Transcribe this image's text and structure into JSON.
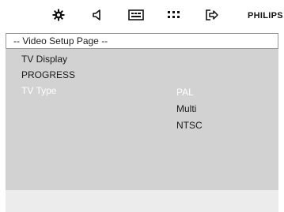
{
  "toolbar": {
    "icons": [
      "gear-icon",
      "speaker-icon",
      "subtitle-icon",
      "dots-grid-icon",
      "exit-icon"
    ],
    "brand": "PHILIPS"
  },
  "page": {
    "title": "-- Video Setup Page --"
  },
  "menu": {
    "items": [
      {
        "label": "TV Display"
      },
      {
        "label": "PROGRESS"
      },
      {
        "label": "TV Type",
        "selected": true
      }
    ]
  },
  "submenu": {
    "options": [
      {
        "label": "PAL",
        "highlighted": true
      },
      {
        "label": "Multi"
      },
      {
        "label": "NTSC"
      }
    ]
  },
  "colors": {
    "panel": "#d2d2d2",
    "highlight_text": "#ffffff",
    "text": "#1a1a1a"
  }
}
